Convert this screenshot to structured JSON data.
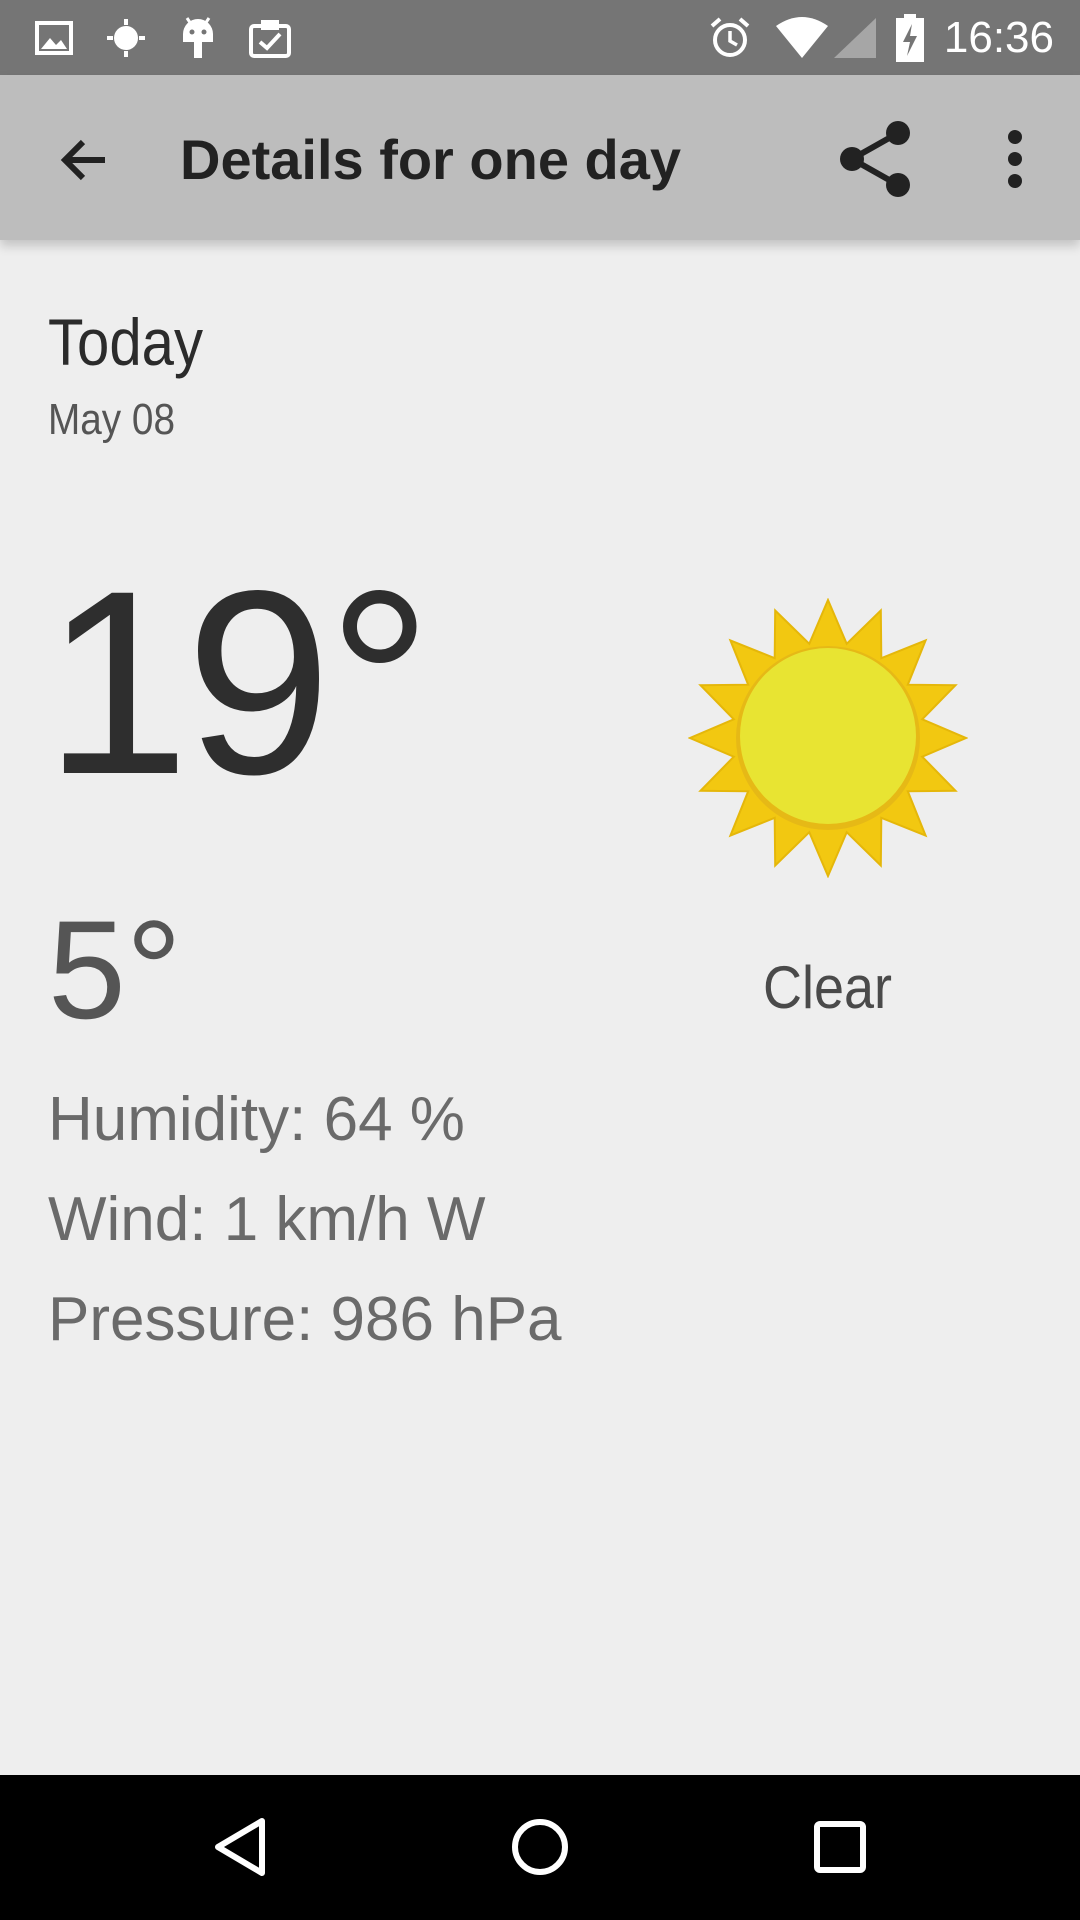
{
  "status_bar": {
    "time": "16:36",
    "left_icons": [
      "image-icon",
      "brightness-icon",
      "android-icon",
      "clipboard-check-icon"
    ],
    "right_icons": [
      "alarm-icon",
      "wifi-icon",
      "cell-signal-icon",
      "battery-charging-icon"
    ]
  },
  "toolbar": {
    "title": "Details for one day",
    "back_icon": "arrow-back-icon",
    "share_icon": "share-icon",
    "more_icon": "more-vert-icon"
  },
  "forecast": {
    "day": "Today",
    "date": "May 08",
    "high": "19°",
    "low": "5°",
    "condition": "Clear",
    "condition_icon": "sun-icon",
    "humidity": "Humidity: 64 %",
    "wind": "Wind: 1 km/h W",
    "pressure": "Pressure: 986 hPa"
  },
  "colors": {
    "status_bar": "#757575",
    "toolbar": "#bdbdbd",
    "background": "#eeeeee",
    "sun_outer": "#f2c811",
    "sun_inner": "#e8e432"
  },
  "nav_bar": {
    "buttons": [
      "back-triangle-icon",
      "home-circle-icon",
      "recents-square-icon"
    ]
  }
}
